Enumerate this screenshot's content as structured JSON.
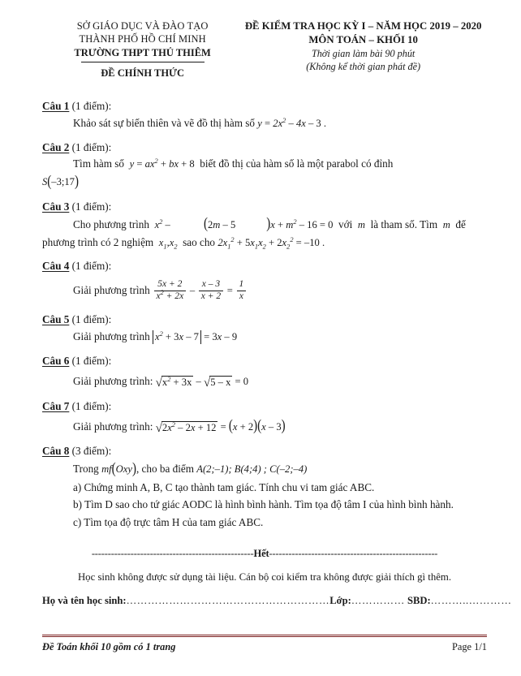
{
  "header": {
    "left": {
      "line1": "SỞ GIÁO DỤC VÀ ĐÀO TẠO",
      "line2": "THÀNH PHỐ HỒ CHÍ MINH",
      "line3": "TRƯỜNG THPT THỦ THIÊM",
      "line4": "ĐỀ CHÍNH THỨC"
    },
    "right": {
      "line1": "ĐỀ KIỂM TRA HỌC KỲ I – NĂM HỌC 2019 – 2020",
      "line2": "MÔN TOÁN – KHỐI 10",
      "line3": "Thời gian làm bài 90 phút",
      "line4": "(Không kể thời gian phát đề)"
    }
  },
  "questions": [
    {
      "label": "Câu 1",
      "points": "(1 điểm):",
      "text_before": "Khảo sát sự biến thiên và vẽ đồ thị hàm số",
      "formula": "y = 2x² – 4x – 3 .",
      "text_after": ""
    },
    {
      "label": "Câu 2",
      "points": "(1 điểm):",
      "text_before": "Tìm hàm số",
      "formula": "y = ax² + bx + 8",
      "text_after": "biết đồ thị của hàm số là một parabol có đỉnh",
      "line2": "S(–3;17)"
    },
    {
      "label": "Câu 3",
      "points": "(1 điểm):",
      "text_before": "Cho phương trình",
      "formula": "x² – (2m – 5)x + m² – 16 = 0",
      "text_mid": "với",
      "param": "m",
      "text_after": "là tham số. Tìm",
      "param2": "m",
      "text_end": "để",
      "line2_before": "phương trình có 2 nghiệm",
      "line2_roots": "x₁,x₂",
      "line2_mid": "sao cho",
      "line2_formula": "2x₁² + 5x₁x₂ + 2x₂² = –10 .",
      "line2_after": ""
    },
    {
      "label": "Câu 4",
      "points": "(1 điểm):",
      "text_before": "Giải phương trình",
      "frac1_num": "5x + 2",
      "frac1_den": "x² + 2x",
      "op1": "–",
      "frac2_num": "x – 3",
      "frac2_den": "x + 2",
      "op2": "=",
      "frac3_num": "1",
      "frac3_den": "x"
    },
    {
      "label": "Câu 5",
      "points": "(1 điểm):",
      "text_before": "Giải phương trình",
      "abs_inner": "x² + 3x – 7",
      "rhs": "= 3x – 9"
    },
    {
      "label": "Câu 6",
      "points": "(1 điểm):",
      "text_before": "Giải phương trình:",
      "sqrt1": "x² + 3x",
      "op": "–",
      "sqrt2": "5 – x",
      "rhs": "= 0"
    },
    {
      "label": "Câu 7",
      "points": "(1 điểm):",
      "text_before": "Giải phương trình:",
      "sqrt1": "2x² – 2x + 12",
      "rhs_eq": "=",
      "rhs_a": "(x + 2)",
      "rhs_b": "(x – 3)"
    },
    {
      "label": "Câu 8",
      "points": "(3 điểm):",
      "intro_before": "Trong",
      "intro_mf": "mf(Oxy)",
      "intro_mid": ", cho ba điểm",
      "points_list": "A(2;–1);  B(4;4) ;  C(–2;–4)",
      "part_a": "a) Chứng minh A, B, C tạo thành tam giác. Tính chu vi tam giác ABC.",
      "part_b": "b) Tìm D sao cho tứ giác AODC là hình bình hành. Tìm tọa độ tâm I của hình bình hành.",
      "part_c": "c) Tìm tọa độ trực tâm H của tam giác ABC."
    }
  ],
  "separator": {
    "dashes_left": "--------------------------------------------------",
    "word": "Hết",
    "dashes_right": "----------------------------------------------------"
  },
  "note": "Học sinh không được sử dụng tài liệu. Cán bộ coi kiểm tra không được giải thích gì thêm.",
  "id_line": {
    "name_label": "Họ và tên học sinh:",
    "name_dots": "…………………………………………………",
    "class_label": "Lớp:",
    "class_dots": "……………",
    "sbd_label": "SBD:",
    "sbd_dots": "………..…………"
  },
  "footer": {
    "left": "Đề Toán khối 10 gồm có 1 trang",
    "right": "Page 1/1",
    "rule_color": "#7b2020"
  }
}
